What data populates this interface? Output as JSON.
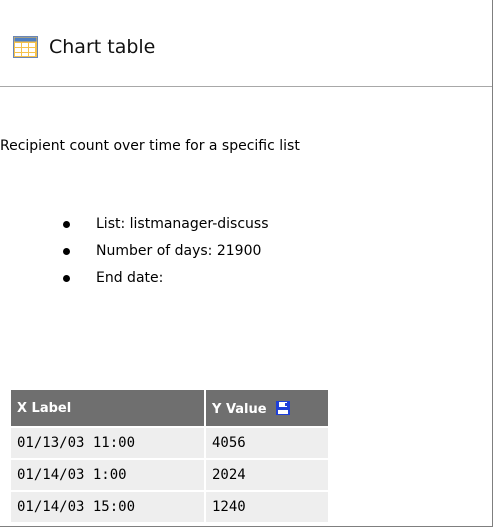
{
  "header": {
    "title": "Chart table"
  },
  "main": {
    "description": "Recipient count over time for a specific list",
    "details": [
      "List: listmanager-discuss",
      "Number of days: 21900",
      "End date:"
    ]
  },
  "table": {
    "columns": [
      "X Label",
      "Y Value"
    ],
    "rows": [
      {
        "x": "01/13/03 11:00",
        "y": "4056"
      },
      {
        "x": "01/14/03 1:00",
        "y": "2024"
      },
      {
        "x": "01/14/03 15:00",
        "y": "1240"
      }
    ]
  },
  "icons": {
    "header": "table-icon",
    "column_action": "save-icon"
  },
  "colors": {
    "header_background": "#6f6f6f",
    "header_text": "#ffffff",
    "row_background": "#eeeeee",
    "icon_orange": "#f4a000",
    "save_icon_blue": "#1e3fd8"
  }
}
